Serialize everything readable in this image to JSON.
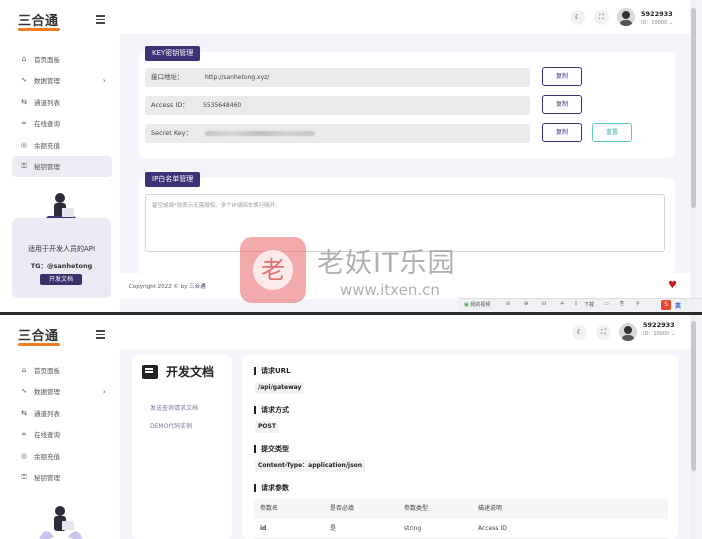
{
  "brand": {
    "logo_text": "三合通",
    "accent": "#f47c20",
    "primary": "#3b3277"
  },
  "sidebar": {
    "items": [
      {
        "icon": "home-icon",
        "glyph": "⌂",
        "label": "首页面板",
        "has_arrow": false,
        "active": false
      },
      {
        "icon": "activity-icon",
        "glyph": "∿",
        "label": "数据管理",
        "has_arrow": true,
        "active": false
      },
      {
        "icon": "channel-icon",
        "glyph": "⇆",
        "label": "通道列表",
        "has_arrow": false,
        "active": false
      },
      {
        "icon": "link-icon",
        "glyph": "∞",
        "label": "在线查询",
        "has_arrow": false,
        "active": false
      },
      {
        "icon": "balance-icon",
        "glyph": "◎",
        "label": "余额充值",
        "has_arrow": false,
        "active": false
      },
      {
        "icon": "key-icon",
        "glyph": "⚿",
        "label": "秘钥管理",
        "has_arrow": false,
        "active": true
      }
    ],
    "arrow_glyph": "›",
    "promo": {
      "text": "适用于开发人员的API",
      "tg": "TG：@sanhetong",
      "button": "开发文档"
    }
  },
  "user": {
    "name": "5922933",
    "id_text": "ID：10000",
    "chevron": "⌄",
    "theme_glyph": "☾",
    "fullscreen_glyph": "⛶"
  },
  "key_panel": {
    "title": "KEY密钥管理",
    "rows": [
      {
        "label": "接口地址：",
        "value": "http://sanhetong.xyz/"
      },
      {
        "label": "Access ID：",
        "value": "5535648460"
      },
      {
        "label": "Secret Key：",
        "value": ""
      }
    ],
    "copy_label": "复制",
    "reset_label": "重置"
  },
  "ip_panel": {
    "title": "IP白名单管理",
    "placeholder": "留空或填*则表示无需授权。多个IP请回车换行隔开。"
  },
  "footer": {
    "text": "Copyright 2022 © by ",
    "link": "三合通",
    "heart": "♥"
  },
  "taskbar": {
    "items": [
      "我的视频",
      "⊘",
      "⊕",
      "☊",
      "✈",
      "⇩",
      "下载",
      "▭",
      "⎘",
      "⚲"
    ],
    "ime": "S",
    "lang": "英"
  },
  "watermark": {
    "logo_char": "老",
    "title": "老妖IT乐园",
    "url": "www.itxen.cn"
  },
  "docs": {
    "title": "开发文档",
    "links": [
      "发送查询请求文档",
      "DEMO代码实例"
    ],
    "sections": {
      "url_head": "请求URL",
      "url": "/api/gateway",
      "method_head": "请求方式",
      "method": "POST",
      "ctype_head": "提交类型",
      "ctype": "Content-Type：application/json",
      "params_head": "请求参数"
    },
    "table": {
      "headers": [
        "参数名",
        "是否必填",
        "参数类型",
        "描述说明"
      ],
      "rows": [
        [
          "id",
          "是",
          "string",
          "Access ID"
        ]
      ]
    }
  }
}
